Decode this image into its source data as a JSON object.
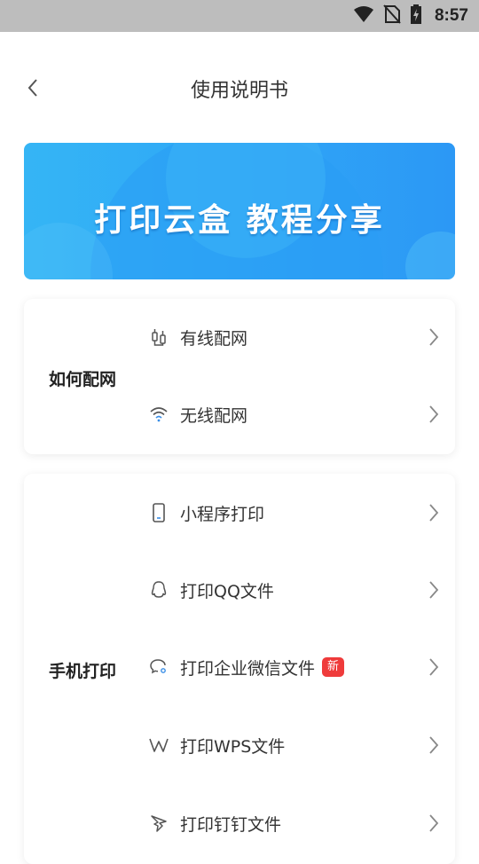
{
  "status_bar": {
    "time": "8:57"
  },
  "header": {
    "title": "使用说明书"
  },
  "banner": {
    "text": "打印云盒 教程分享"
  },
  "sections": [
    {
      "label": "如何配网",
      "items": [
        {
          "label": "有线配网",
          "icon": "cable-icon"
        },
        {
          "label": "无线配网",
          "icon": "wifi-icon"
        }
      ]
    },
    {
      "label": "手机打印",
      "items": [
        {
          "label": "小程序打印",
          "icon": "phone-icon"
        },
        {
          "label": "打印QQ文件",
          "icon": "qq-icon"
        },
        {
          "label": "打印企业微信文件",
          "icon": "wecom-icon",
          "badge": "新"
        },
        {
          "label": "打印WPS文件",
          "icon": "wps-icon"
        },
        {
          "label": "打印钉钉文件",
          "icon": "dingtalk-icon"
        }
      ]
    }
  ],
  "colors": {
    "banner_start": "#35b5f5",
    "banner_end": "#2c98f5",
    "badge": "#ef3b3b"
  }
}
